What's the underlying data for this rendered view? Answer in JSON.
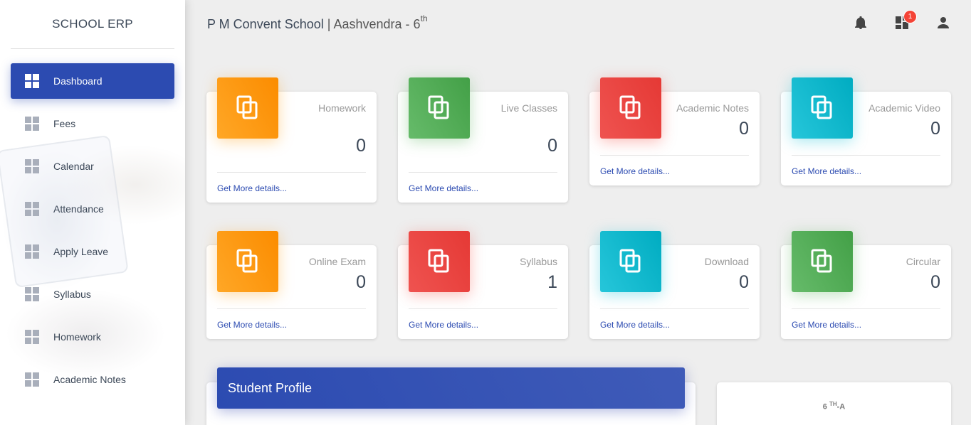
{
  "sidebar": {
    "brand": "SCHOOL ERP",
    "items": [
      {
        "label": "Dashboard",
        "active": true
      },
      {
        "label": "Fees"
      },
      {
        "label": "Calendar"
      },
      {
        "label": "Attendance"
      },
      {
        "label": "Apply Leave"
      },
      {
        "label": "Syllabus"
      },
      {
        "label": "Homework"
      },
      {
        "label": "Academic Notes"
      }
    ]
  },
  "header": {
    "school": "P M Convent School",
    "separator": "|",
    "student": "Aashvendra - 6",
    "student_sup": "th",
    "icons": [
      "bell-icon",
      "dashboard-icon",
      "person-icon"
    ],
    "notification_count": "1"
  },
  "cards": [
    {
      "title": "Homework",
      "value": "0",
      "link": "Get More details...",
      "color": "#fb8c00"
    },
    {
      "title": "Live Classes",
      "value": "0",
      "link": "Get More details...",
      "color": "#43a047"
    },
    {
      "title": "Academic Notes",
      "value": "0",
      "link": "Get More details...",
      "color": "#e53935"
    },
    {
      "title": "Academic Video",
      "value": "0",
      "link": "Get More details...",
      "color": "#00acc1"
    },
    {
      "title": "Online Exam",
      "value": "0",
      "link": "Get More details...",
      "color": "#fb8c00"
    },
    {
      "title": "Syllabus",
      "value": "1",
      "link": "Get More details...",
      "color": "#e53935"
    },
    {
      "title": "Download",
      "value": "0",
      "link": "Get More details...",
      "color": "#00acc1"
    },
    {
      "title": "Circular",
      "value": "0",
      "link": "Get More details...",
      "color": "#43a047"
    }
  ],
  "profile": {
    "title": "Student Profile",
    "class_main": "6",
    "class_sup": "TH",
    "class_suffix": "-A"
  }
}
